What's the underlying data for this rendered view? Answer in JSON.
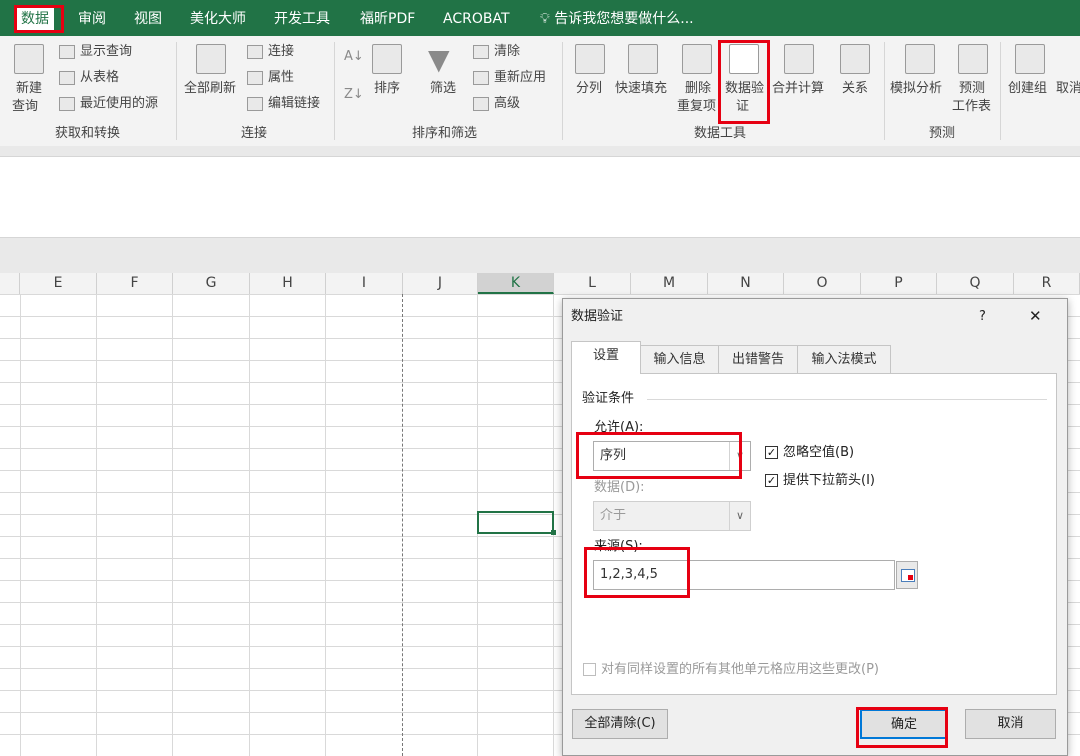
{
  "menu": {
    "tabs": [
      "数据",
      "审阅",
      "视图",
      "美化大师",
      "开发工具",
      "福昕PDF",
      "ACROBAT"
    ],
    "active": "数据",
    "tell_me": "告诉我您想要做什么..."
  },
  "ribbon": {
    "get_transform": {
      "new_query": "新建",
      "new_query2": "查询",
      "show_queries": "显示查询",
      "from_table": "从表格",
      "recent_sources": "最近使用的源",
      "group": "获取和转换"
    },
    "connections": {
      "refresh_all": "全部刷新",
      "connections": "连接",
      "properties": "属性",
      "edit_links": "编辑链接",
      "group": "连接"
    },
    "sort_filter": {
      "sort": "排序",
      "filter": "筛选",
      "clear": "清除",
      "reapply": "重新应用",
      "advanced": "高级",
      "group": "排序和筛选"
    },
    "data_tools": {
      "text_to_columns": "分列",
      "flash_fill": "快速填充",
      "remove_dup": "删除",
      "remove_dup2": "重复项",
      "validation": "数据验",
      "validation2": "证",
      "consolidate": "合并计算",
      "relationships": "关系",
      "group": "数据工具"
    },
    "forecast": {
      "what_if": "模拟分析",
      "forecast_sheet": "预测",
      "forecast_sheet2": "工作表",
      "group": "预测"
    },
    "outline": {
      "group_btn": "创建组",
      "ungroup": "取消"
    }
  },
  "sheet": {
    "columns": [
      "E",
      "F",
      "G",
      "H",
      "I",
      "J",
      "K",
      "L",
      "M",
      "N",
      "O",
      "P",
      "Q",
      "R"
    ],
    "selected_column": "K"
  },
  "dialog": {
    "title": "数据验证",
    "help": "?",
    "close": "✕",
    "tabs": [
      "设置",
      "输入信息",
      "出错警告",
      "输入法模式"
    ],
    "active_tab": "设置",
    "section": "验证条件",
    "allow_label": "允许(A):",
    "allow_value": "序列",
    "ignore_blank": "忽略空值(B)",
    "in_cell_dropdown": "提供下拉箭头(I)",
    "data_label": "数据(D):",
    "data_value": "介于",
    "source_label": "来源(S):",
    "source_value": "1,2,3,4,5",
    "apply_all": "对有同样设置的所有其他单元格应用这些更改(P)",
    "clear_all": "全部清除(C)",
    "ok": "确定",
    "cancel": "取消"
  },
  "colors": {
    "excel_green": "#217346",
    "highlight_red": "#e60012",
    "accent_blue": "#0078d7"
  }
}
